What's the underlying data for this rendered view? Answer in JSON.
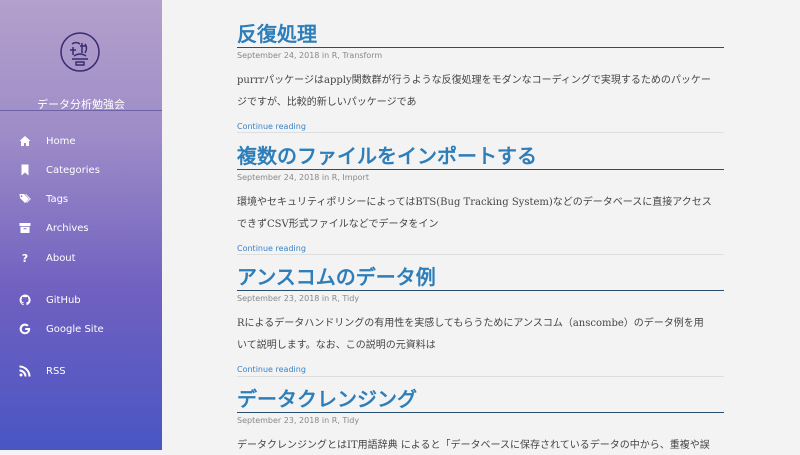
{
  "sidebar": {
    "site_title": "データ分析勉強会",
    "nav": [
      {
        "label": "Home",
        "icon": "home-icon"
      },
      {
        "label": "Categories",
        "icon": "bookmark-icon"
      },
      {
        "label": "Tags",
        "icon": "tags-icon"
      },
      {
        "label": "Archives",
        "icon": "archive-icon"
      },
      {
        "label": "About",
        "icon": "question-icon"
      }
    ],
    "links": [
      {
        "label": "GitHub",
        "icon": "github-icon"
      },
      {
        "label": "Google Site",
        "icon": "google-icon"
      }
    ],
    "rss": {
      "label": "RSS",
      "icon": "rss-icon"
    }
  },
  "posts": [
    {
      "title": "反復処理",
      "meta": "September 24, 2018 in R, Transform",
      "excerpt_l1": "purrrパッケージはapply関数群が行うような反復処理をモダンなコーディングで実現するためのパッケー",
      "excerpt_l2": "ジですが、比較的新しいパッケージであ",
      "more": "Continue reading"
    },
    {
      "title": "複数のファイルをインポートする",
      "meta": "September 24, 2018 in R, Import",
      "excerpt_l1": "環境やセキュリティポリシーによってはBTS(Bug Tracking System)などのデータベースに直接アクセス",
      "excerpt_l2": "できずCSV形式ファイルなどでデータをイン",
      "more": "Continue reading"
    },
    {
      "title": "アンスコムのデータ例",
      "meta": "September 23, 2018 in R, Tidy",
      "excerpt_l1": "Rによるデータハンドリングの有用性を実感してもらうためにアンスコム（anscombe）のデータ例を用",
      "excerpt_l2": "いて説明します。なお、この説明の元資料は",
      "more": "Continue reading"
    },
    {
      "title": "データクレンジング",
      "meta": "September 23, 2018 in R, Tidy",
      "excerpt_l1": "データクレンジングとはIT用語辞典 によると「データベースに保存されているデータの中から、重複や誤",
      "excerpt_l2": "",
      "more": ""
    }
  ]
}
